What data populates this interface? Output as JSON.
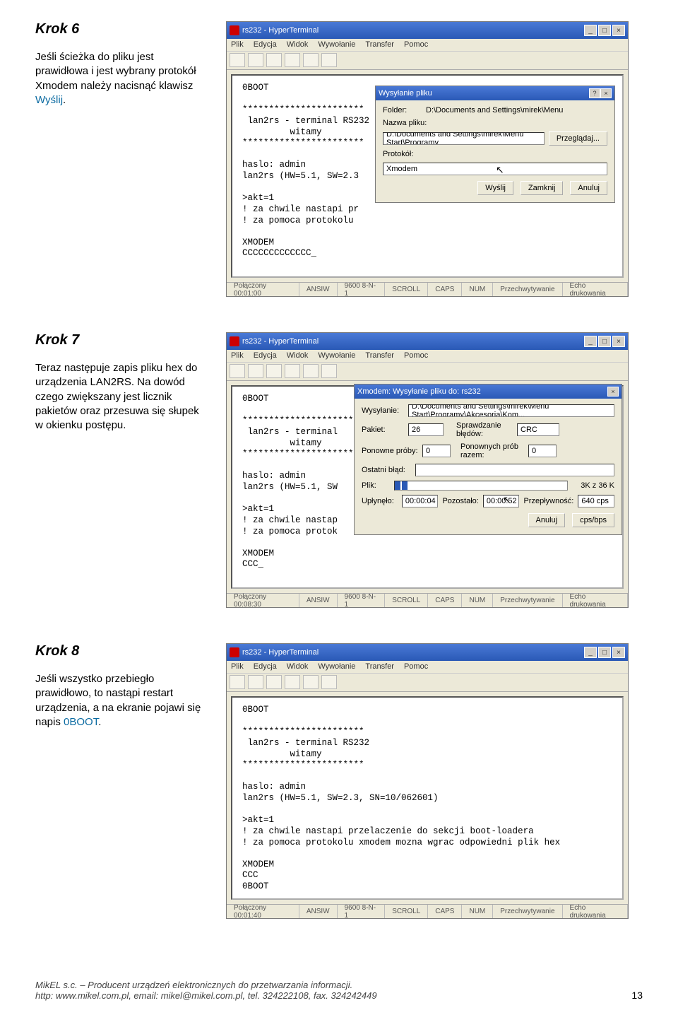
{
  "steps": {
    "k6": {
      "title": "Krok 6",
      "body_a": "Jeśli ścieżka do pliku jest prawidłowa i jest wybrany protokół Xmodem należy nacisnąć klawisz ",
      "body_hl": "Wyślij",
      "body_b": "."
    },
    "k7": {
      "title": "Krok 7",
      "body": "Teraz następuje zapis pliku hex do urządzenia LAN2RS. Na dowód czego zwiększany jest licznik pakietów oraz przesuwa się słupek w okienku postępu."
    },
    "k8": {
      "title": "Krok 8",
      "body_a": "Jeśli wszystko przebiegło prawidłowo, to nastąpi restart urządzenia, a na ekranie pojawi się napis ",
      "body_hl": "0BOOT",
      "body_b": "."
    }
  },
  "window": {
    "title": "rs232 - HyperTerminal",
    "menu": [
      "Plik",
      "Edycja",
      "Widok",
      "Wywołanie",
      "Transfer",
      "Pomoc"
    ]
  },
  "terminal": {
    "k6": "0BOOT\n\n***********************\n lan2rs - terminal RS232\n         witamy\n***********************\n\nhaslo: admin\nlan2rs (HW=5.1, SW=2.3\n\n>akt=1\n! za chwile nastapi pr\n! za pomoca protokolu \n\nXMODEM\nCCCCCCCCCCCCC_",
    "k7": "0BOOT\n\n***********************\n lan2rs - terminal\n         witamy\n***********************\n\nhaslo: admin\nlan2rs (HW=5.1, SW\n\n>akt=1\n! za chwile nastap\n! za pomoca protok\n\nXMODEM\nCCC_",
    "k8": "0BOOT\n\n***********************\n lan2rs - terminal RS232\n         witamy\n***********************\n\nhaslo: admin\nlan2rs (HW=5.1, SW=2.3, SN=10/062601)\n\n>akt=1\n! za chwile nastapi przelaczenie do sekcji boot-loadera\n! za pomoca protokolu xmodem mozna wgrac odpowiedni plik hex\n\nXMODEM\nCCC\n0BOOT"
  },
  "status": {
    "k6": {
      "conn": "Połączony 00:01:00",
      "term": "ANSIW",
      "cfg": "9600 8-N-1",
      "scroll": "SCROLL",
      "caps": "CAPS",
      "num": "NUM",
      "cap1": "Przechwytywanie",
      "cap2": "Echo drukowania"
    },
    "k7": {
      "conn": "Połączony 00:08:30",
      "term": "ANSIW",
      "cfg": "9600 8-N-1",
      "scroll": "SCROLL",
      "caps": "CAPS",
      "num": "NUM",
      "cap1": "Przechwytywanie",
      "cap2": "Echo drukowania"
    },
    "k8": {
      "conn": "Połączony 00:01:40",
      "term": "ANSIW",
      "cfg": "9600 8-N-1",
      "scroll": "SCROLL",
      "caps": "CAPS",
      "num": "NUM",
      "cap1": "Przechwytywanie",
      "cap2": "Echo drukowania"
    }
  },
  "dialog_send": {
    "title": "Wysyłanie pliku",
    "folder_lbl": "Folder:",
    "folder_val": "D:\\Documents and Settings\\mirek\\Menu",
    "file_lbl": "Nazwa pliku:",
    "file_val": "D:\\Documents and Settings\\mirek\\Menu Start\\Programy",
    "browse": "Przeglądaj...",
    "proto_lbl": "Protokół:",
    "proto_val": "Xmodem",
    "btn_send": "Wyślij",
    "btn_close": "Zamknij",
    "btn_cancel": "Anuluj"
  },
  "dialog_prog": {
    "title": "Xmodem: Wysyłanie pliku do: rs232",
    "send_lbl": "Wysyłanie:",
    "send_val": "D:\\Documents and Settings\\mirek\\Menu Start\\Programy\\Akcesoria\\Kom...",
    "pkt_lbl": "Pakiet:",
    "pkt_val": "26",
    "errchk_lbl": "Sprawdzanie błędów:",
    "errchk_val": "CRC",
    "retry_lbl": "Ponowne próby:",
    "retry_val": "0",
    "retrytot_lbl": "Ponownych prób razem:",
    "retrytot_val": "0",
    "lasterr_lbl": "Ostatni błąd:",
    "lasterr_val": "",
    "file_lbl": "Plik:",
    "file_prog": "##",
    "file_size": "3K z 36 K",
    "elapsed_lbl": "Upłynęło:",
    "elapsed_val": "00:00:04",
    "remain_lbl": "Pozostało:",
    "remain_val": "00:00:52",
    "thru_lbl": "Przepływność:",
    "thru_val": "640 cps",
    "btn_cancel": "Anuluj",
    "btn_cps": "cps/bps"
  },
  "footer": {
    "line1": "MikEL s.c. – Producent urządzeń elektronicznych do przetwarzania informacji.",
    "line2": "http: www.mikel.com.pl, email: mikel@mikel.com.pl, tel. 324222108, fax. 324242449",
    "page": "13"
  }
}
